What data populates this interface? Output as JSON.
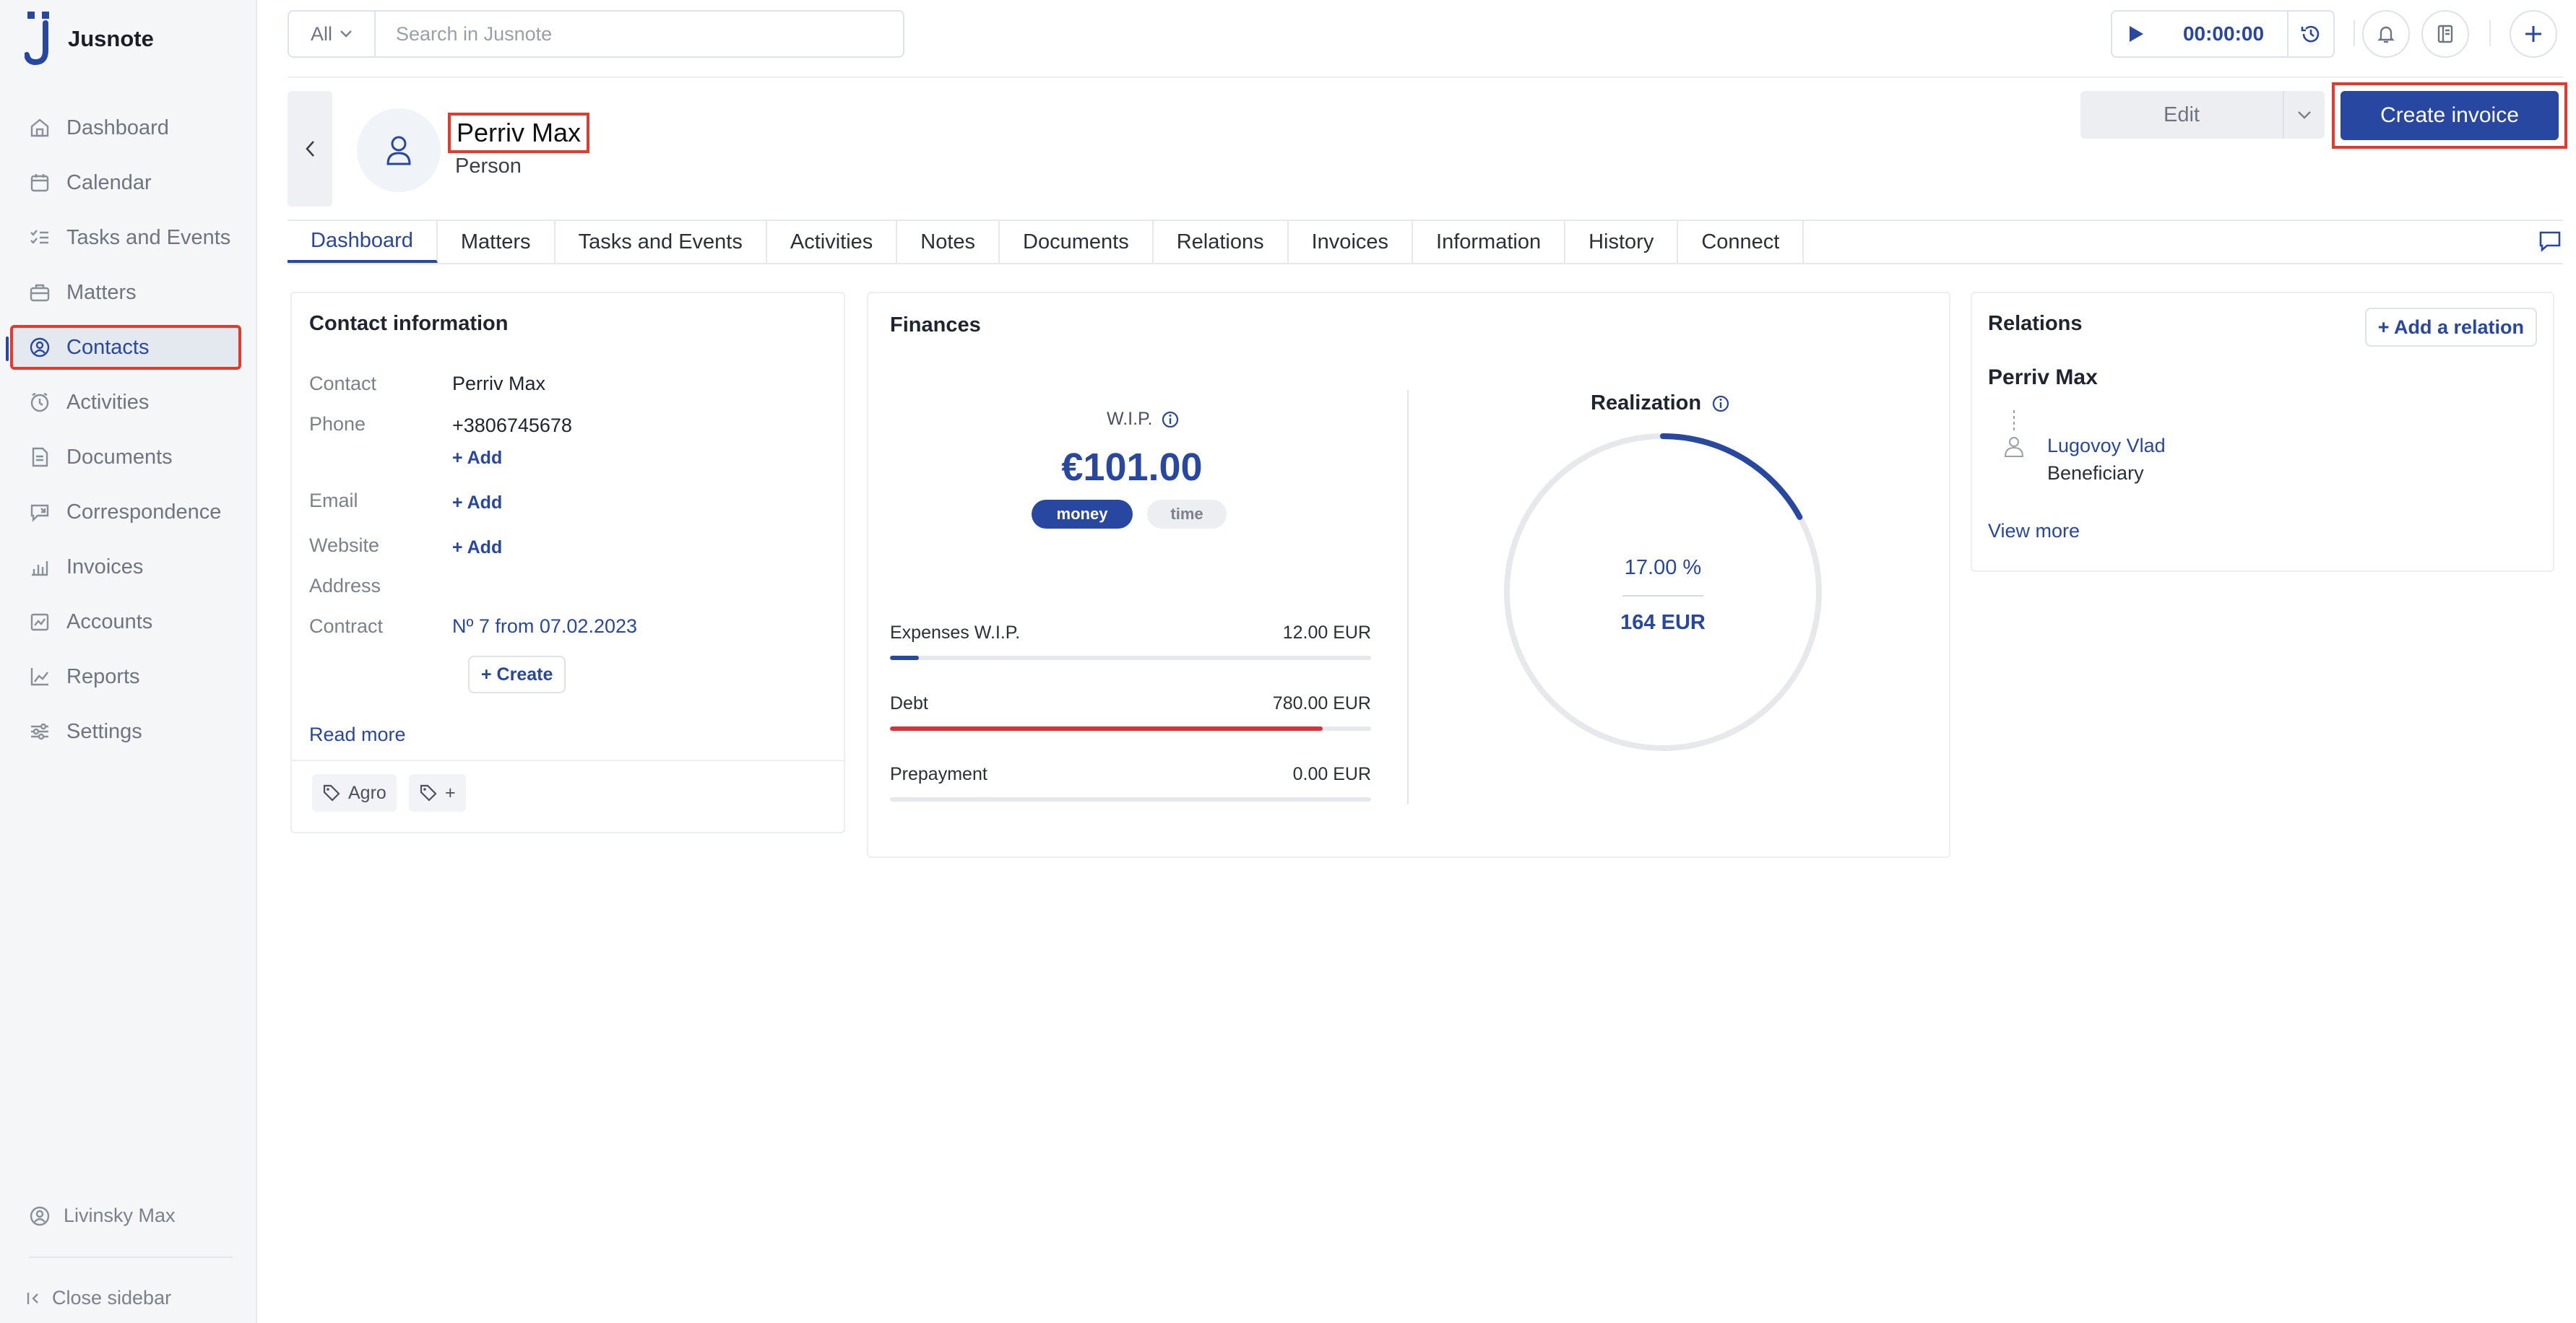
{
  "app": {
    "name": "Jusnote"
  },
  "sidebar": {
    "items": [
      {
        "label": "Dashboard",
        "icon": "dashboard-icon"
      },
      {
        "label": "Calendar",
        "icon": "calendar-icon"
      },
      {
        "label": "Tasks and Events",
        "icon": "tasks-icon"
      },
      {
        "label": "Matters",
        "icon": "briefcase-icon"
      },
      {
        "label": "Contacts",
        "icon": "contacts-icon",
        "active": true
      },
      {
        "label": "Activities",
        "icon": "clock-icon"
      },
      {
        "label": "Documents",
        "icon": "document-icon"
      },
      {
        "label": "Correspondence",
        "icon": "correspondence-icon"
      },
      {
        "label": "Invoices",
        "icon": "invoice-icon"
      },
      {
        "label": "Accounts",
        "icon": "accounts-icon"
      },
      {
        "label": "Reports",
        "icon": "reports-icon"
      },
      {
        "label": "Settings",
        "icon": "settings-icon"
      }
    ],
    "user": "Livinsky Max",
    "close_label": "Close sidebar"
  },
  "topbar": {
    "search_scope": "All",
    "search_placeholder": "Search in Jusnote",
    "timer": "00:00:00"
  },
  "header": {
    "name": "Perriv Max",
    "type": "Person",
    "edit_label": "Edit",
    "create_invoice_label": "Create invoice"
  },
  "tabs": [
    "Dashboard",
    "Matters",
    "Tasks and Events",
    "Activities",
    "Notes",
    "Documents",
    "Relations",
    "Invoices",
    "Information",
    "History",
    "Connect"
  ],
  "contact_info": {
    "title": "Contact information",
    "contact_label": "Contact",
    "contact_value": "Perriv Max",
    "phone_label": "Phone",
    "phone_value": "+3806745678",
    "email_label": "Email",
    "website_label": "Website",
    "address_label": "Address",
    "contract_label": "Contract",
    "contract_value": "Nº 7 from 07.02.2023",
    "add_label": "+ Add",
    "create_label": "+ Create",
    "read_more": "Read more",
    "tags": [
      "Agro",
      "+"
    ]
  },
  "finances": {
    "title": "Finances",
    "wip_label": "W.I.P.",
    "wip_value": "€101.00",
    "toggle_money": "money",
    "toggle_time": "time",
    "rows": [
      {
        "label": "Expenses W.I.P.",
        "amount": "12.00 EUR",
        "progress": 0.06,
        "color": "#2747a0"
      },
      {
        "label": "Debt",
        "amount": "780.00 EUR",
        "progress": 0.9,
        "color": "#d6333a"
      },
      {
        "label": "Prepayment",
        "amount": "0.00 EUR",
        "progress": 0,
        "color": "#2747a0"
      }
    ],
    "realization_label": "Realization",
    "realization_percent": "17.00 %",
    "realization_fraction": 0.17,
    "realization_amount": "164 EUR"
  },
  "relations": {
    "title": "Relations",
    "add_label": "+ Add a relation",
    "contact_name": "Perriv Max",
    "related_person": "Lugovoy Vlad",
    "related_role": "Beneficiary",
    "view_more": "View more"
  },
  "colors": {
    "accent": "#2747a0",
    "highlight": "#e23b2e",
    "debt": "#d6333a"
  }
}
